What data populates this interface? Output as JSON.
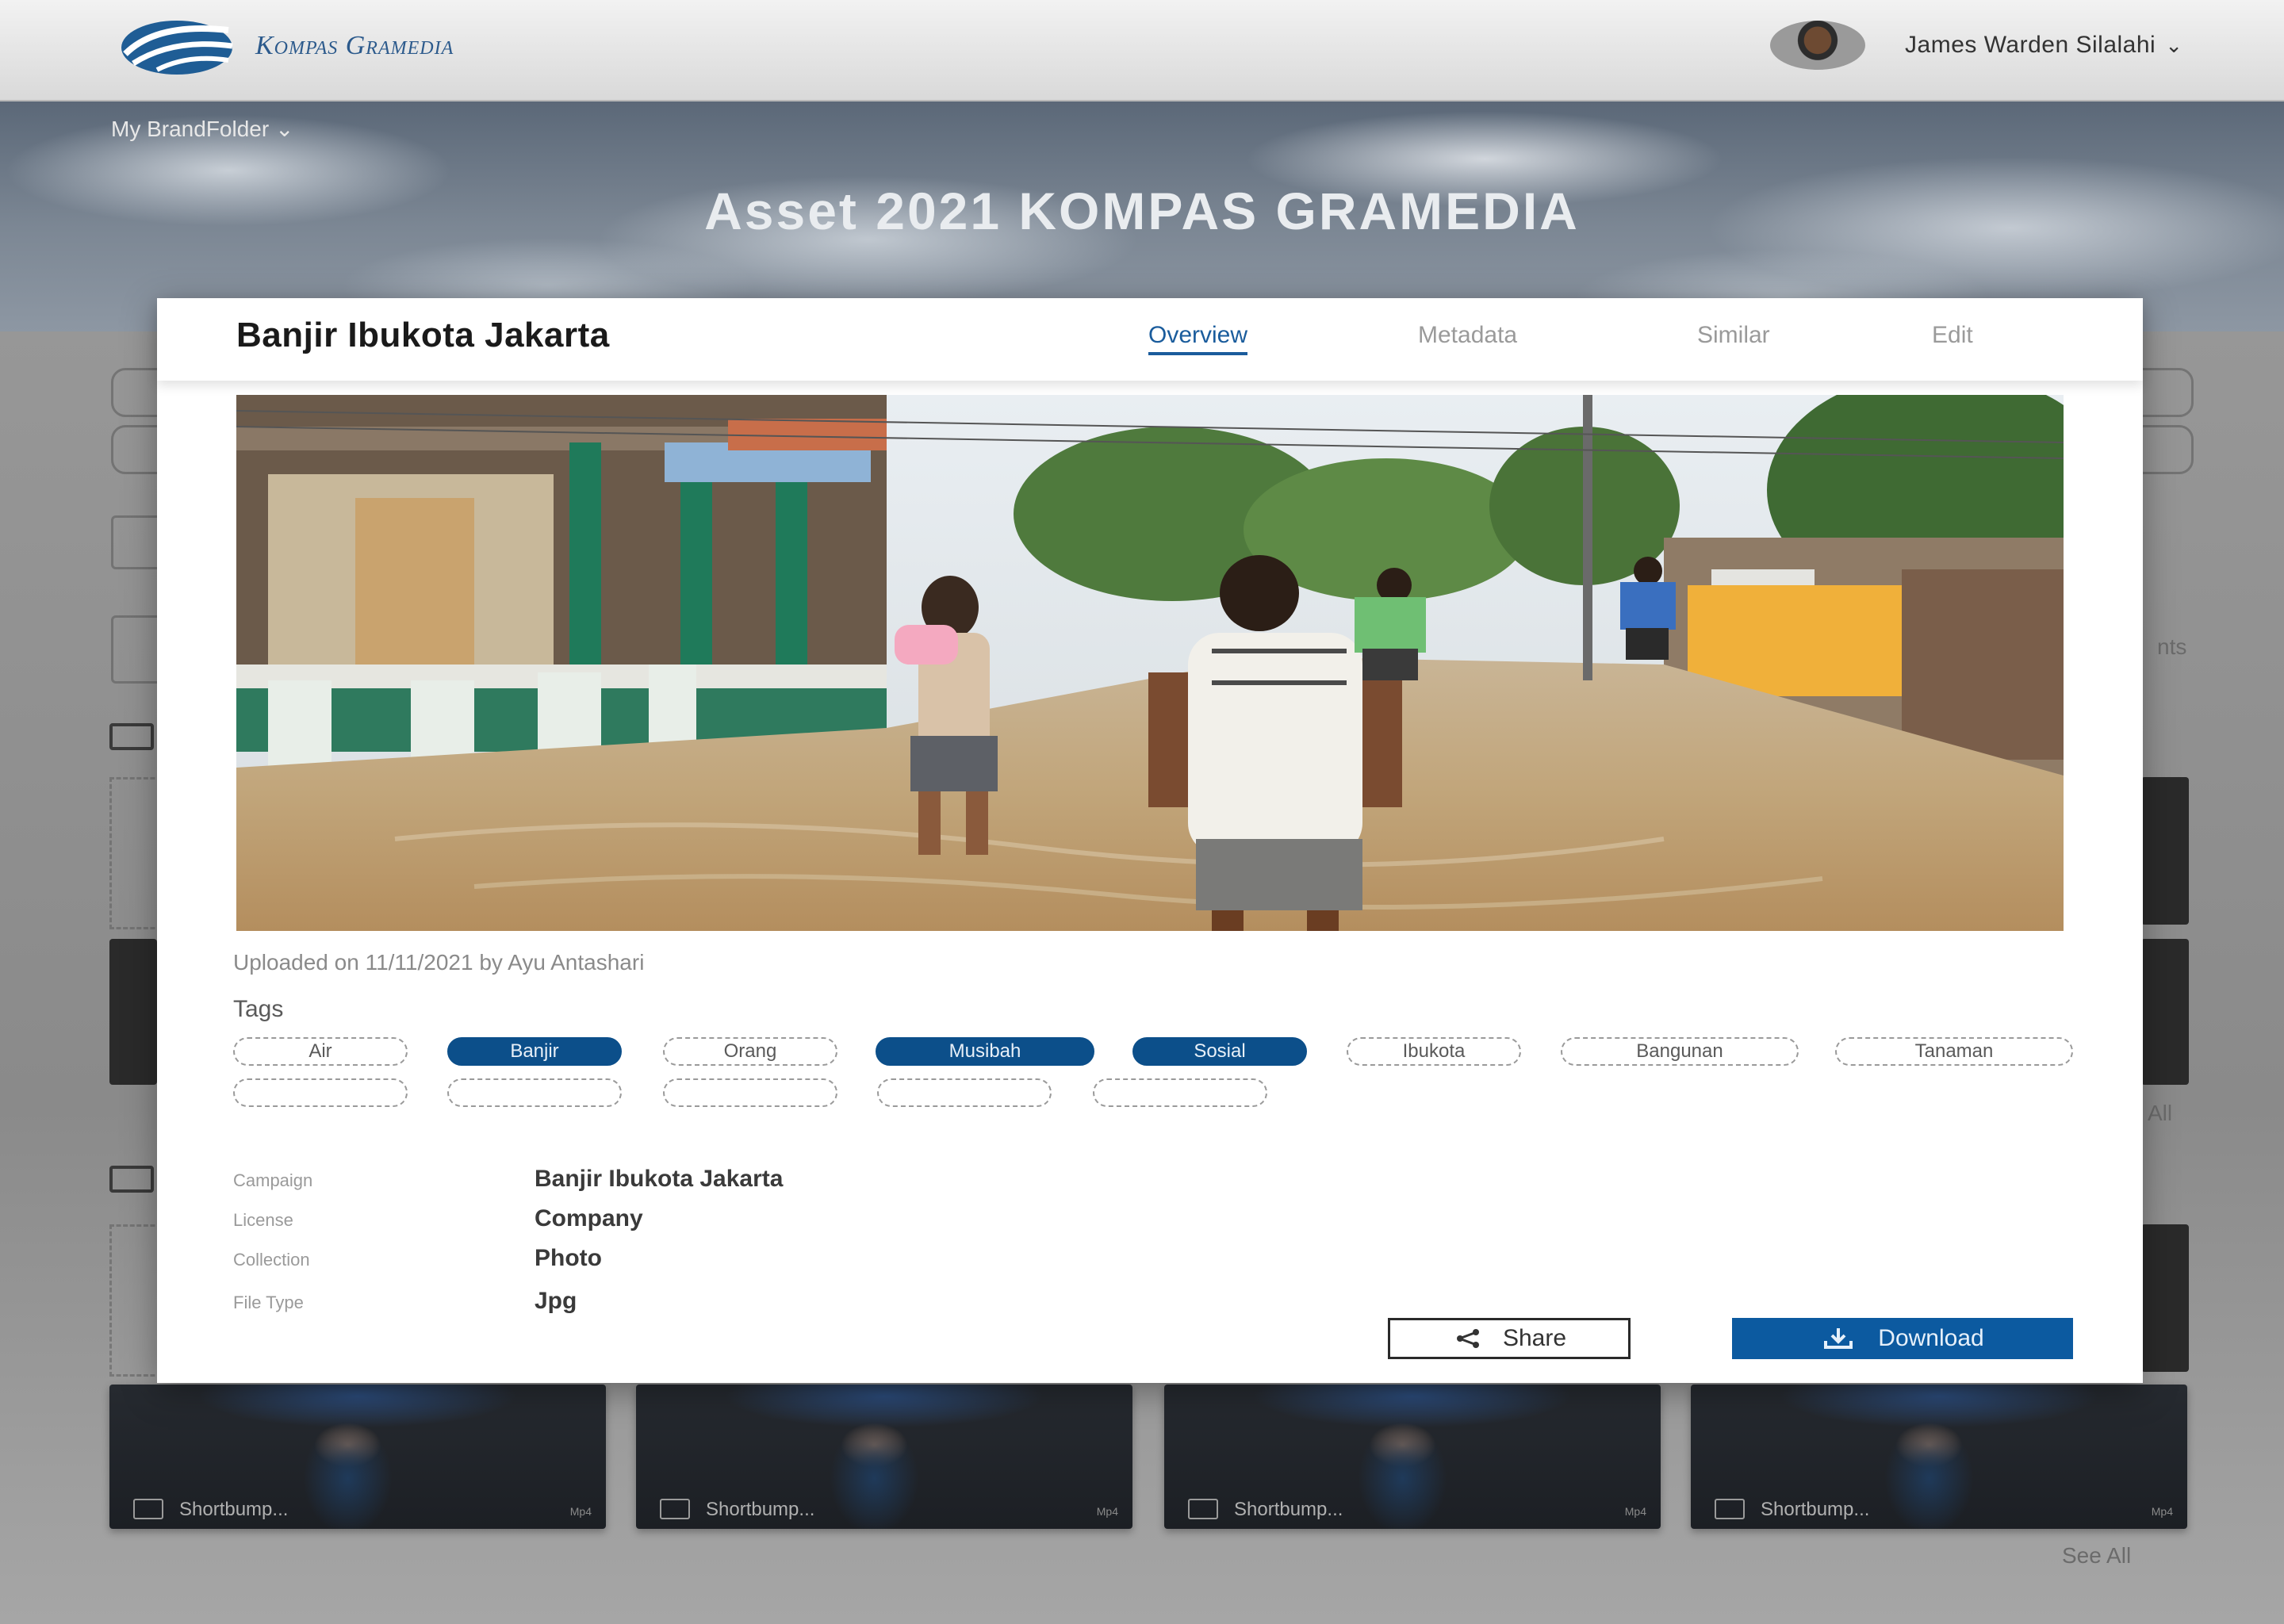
{
  "topbar": {
    "logo_text": "Kompas Gramedia",
    "user_name": "James Warden Silalahi",
    "user_chevron": "⌄"
  },
  "hero": {
    "breadcrumb": "My BrandFolder ⌄",
    "title": "Asset 2021 KOMPAS GRAMEDIA"
  },
  "background": {
    "tiles": [
      {
        "label": "Shortbump...",
        "ext": "Mp4"
      },
      {
        "label": "Shortbump...",
        "ext": "Mp4"
      },
      {
        "label": "Shortbump...",
        "ext": "Mp4"
      },
      {
        "label": "Shortbump...",
        "ext": "Mp4"
      }
    ],
    "see_all": "See All",
    "see_all_partial": "All",
    "partial_text": "nts"
  },
  "modal": {
    "title": "Banjir Ibukota Jakarta",
    "tabs": [
      {
        "label": "Overview",
        "active": true
      },
      {
        "label": "Metadata",
        "active": false
      },
      {
        "label": "Similar",
        "active": false
      },
      {
        "label": "Edit",
        "active": false
      }
    ],
    "upload_info": "Uploaded on 11/11/2021 by Ayu Antashari",
    "tags_heading": "Tags",
    "tags": [
      {
        "label": "Air",
        "selected": false
      },
      {
        "label": "Banjir",
        "selected": true
      },
      {
        "label": "Orang",
        "selected": false
      },
      {
        "label": "Musibah",
        "selected": true
      },
      {
        "label": "Sosial",
        "selected": true
      },
      {
        "label": "Ibukota",
        "selected": false
      },
      {
        "label": "Bangunan",
        "selected": false
      },
      {
        "label": "Tanaman",
        "selected": false
      }
    ],
    "metadata": [
      {
        "label": "Campaign",
        "value": "Banjir Ibukota Jakarta"
      },
      {
        "label": "License",
        "value": "Company"
      },
      {
        "label": "Collection",
        "value": "Photo"
      },
      {
        "label": "File Type",
        "value": "Jpg"
      }
    ],
    "share_label": "Share",
    "download_label": "Download",
    "share_icon": "share-icon",
    "download_icon": "download-icon"
  },
  "colors": {
    "accent": "#0c5aa0",
    "tag_selected": "#0c4f8a",
    "active_tab": "#1a5c9c"
  }
}
